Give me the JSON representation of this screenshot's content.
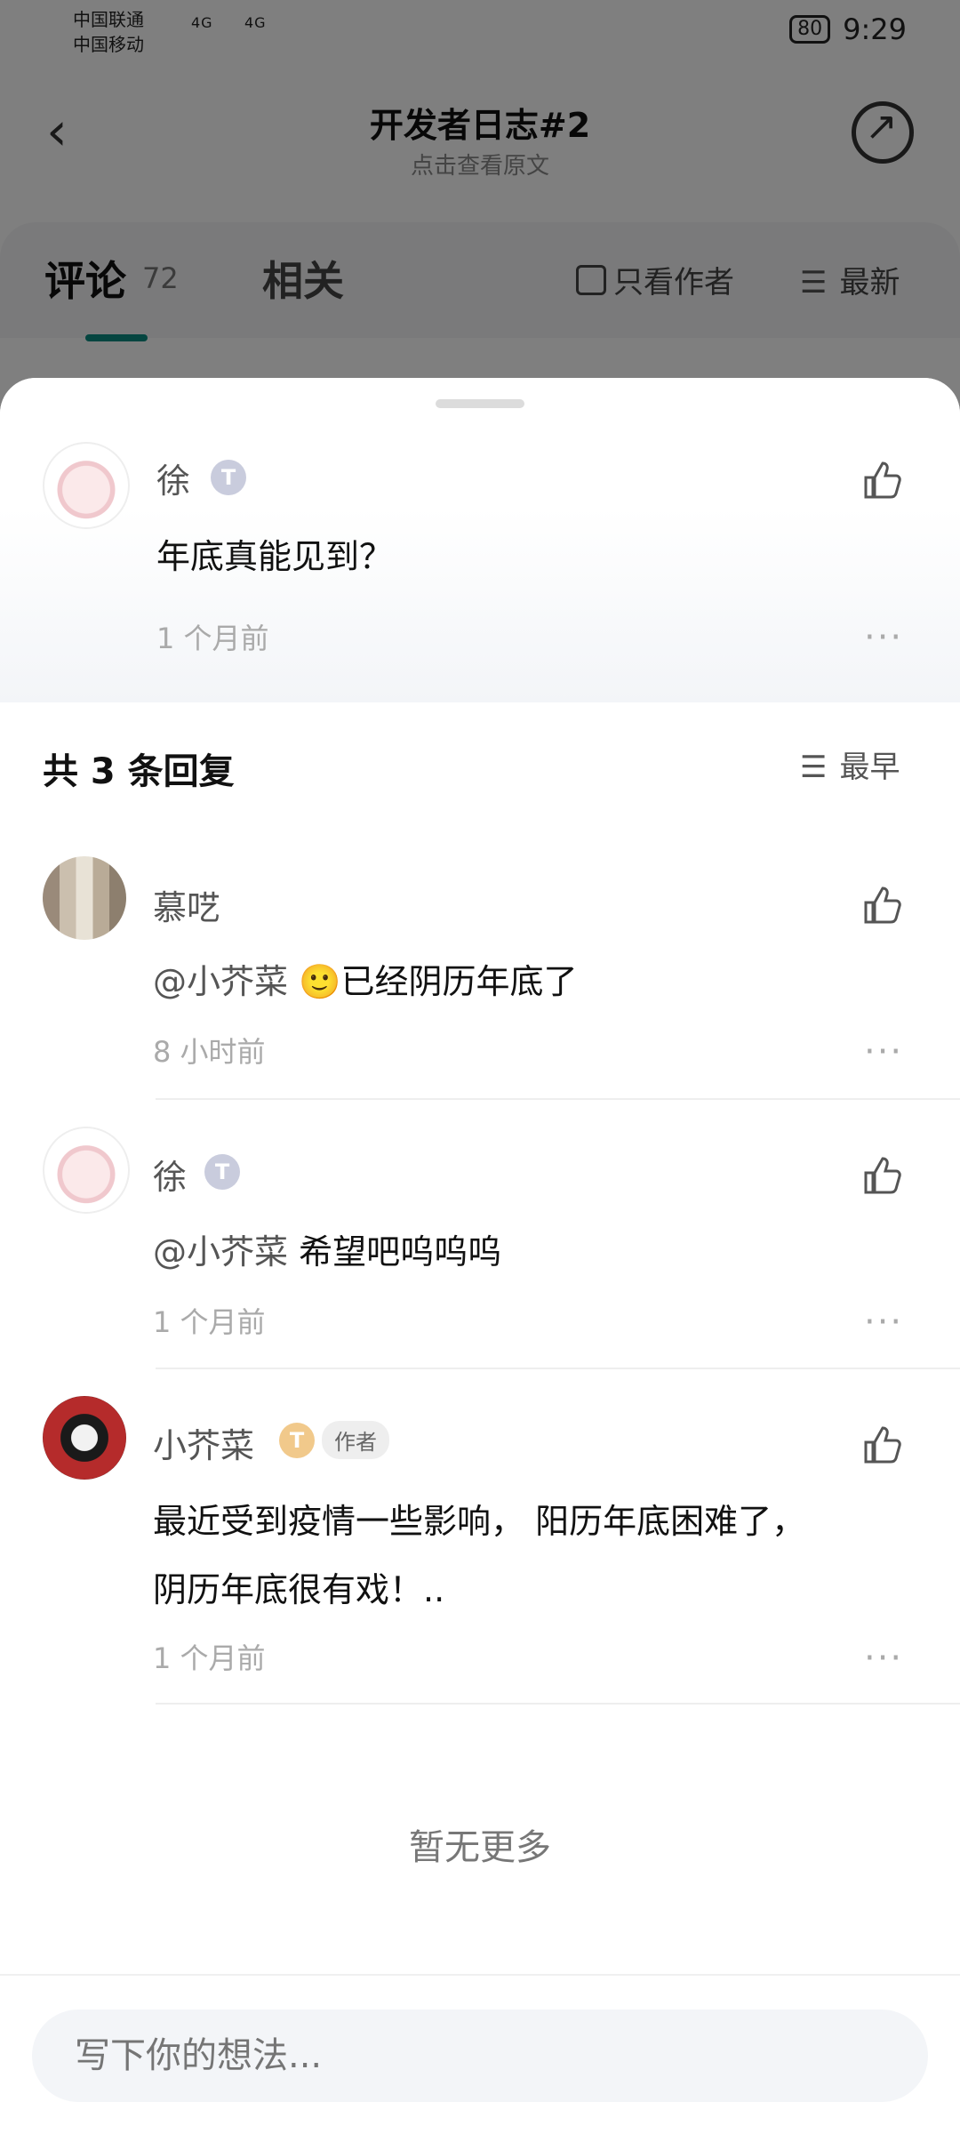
{
  "status_bar": {
    "carrier1": "中国联通",
    "carrier2": "中国移动",
    "net1": "4G",
    "net2": "4G",
    "battery": "80",
    "time": "9:29"
  },
  "header": {
    "title": "开发者日志#2",
    "subtitle": "点击查看原文"
  },
  "tabs": {
    "comments_label": "评论",
    "comments_count": "72",
    "related_label": "相关",
    "author_only": "只看作者",
    "sort": "最新"
  },
  "original_comment": {
    "user": "徐",
    "level": "3",
    "text": "年底真能见到？",
    "time": "1 个月前"
  },
  "replies": {
    "heading": "共 3 条回复",
    "sort": "最早",
    "items": [
      {
        "user": "慕呓",
        "mention": "@小芥菜",
        "emoji": "🙂",
        "text": "已经阴历年底了",
        "time": "8 小时前"
      },
      {
        "user": "徐",
        "level": "3",
        "mention": "@小芥菜",
        "text": "希望吧呜呜呜",
        "time": "1 个月前"
      },
      {
        "user": "小芥菜",
        "level": "4",
        "author_tag": "作者",
        "text_line1": "最近受到疫情一些影响，  阳历年底困难了，",
        "text_line2": "阴历年底很有戏！..",
        "time": "1 个月前"
      }
    ]
  },
  "no_more": "暂无更多",
  "input": {
    "placeholder": "写下你的想法..."
  },
  "colors": {
    "accent": "#0b8b80",
    "gold_level": "#f1c98b"
  }
}
